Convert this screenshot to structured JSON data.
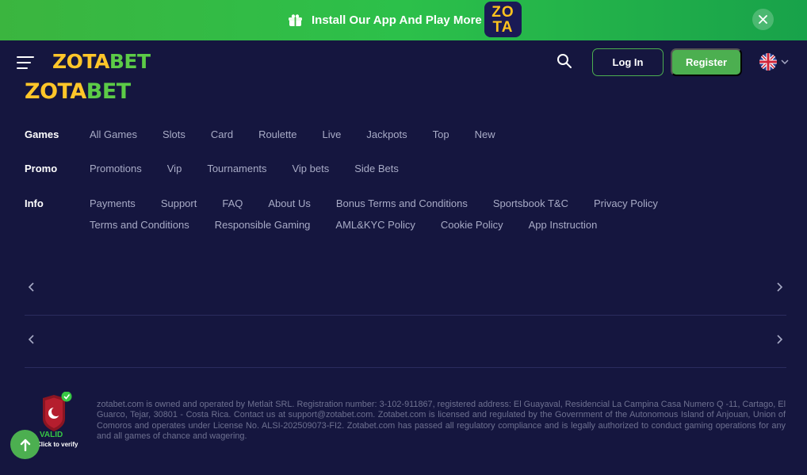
{
  "banner": {
    "text": "Install Our App And Play More",
    "app_icon_top": "ZO",
    "app_icon_bottom": "TA"
  },
  "brand": {
    "logo_part1": "ZOTA",
    "logo_part2": "BET",
    "gold": "#ffc629",
    "green": "#5ccb47",
    "accent": "#4caf50"
  },
  "header": {
    "login_label": "Log In",
    "register_label": "Register",
    "language_icon": "uk-flag-icon"
  },
  "nav": {
    "games": {
      "title": "Games",
      "links": [
        "All Games",
        "Slots",
        "Card",
        "Roulette",
        "Live",
        "Jackpots",
        "Top",
        "New"
      ]
    },
    "promo": {
      "title": "Promo",
      "links": [
        "Promotions",
        "Vip",
        "Tournaments",
        "Vip bets",
        "Side Bets"
      ]
    },
    "info": {
      "title": "Info",
      "links": [
        "Payments",
        "Support",
        "FAQ",
        "About Us",
        "Bonus Terms and Conditions",
        "Sportsbook T&C",
        "Privacy Policy",
        "Terms and Conditions",
        "Responsible Gaming",
        "AML&KYC Policy",
        "Cookie Policy",
        "App Instruction"
      ]
    }
  },
  "badge": {
    "status": "VALID",
    "action": "Click to verify"
  },
  "legal": {
    "text": "zotabet.com is owned and operated by Metlait SRL. Registration number: 3-102-911867, registered address: El Guayaval, Residencial La Campina Casa Numero Q -11, Cartago, El Guarco, Tejar, 30801 - Costa Rica. Contact us at support@zotabet.com. Zotabet.com is licensed and regulated by the Government of the Autonomous Island of Anjouan, Union of Comoros and operates under License No. ALSI-202509073-FI2. Zotabet.com has passed all regulatory compliance and is legally authorized to conduct gaming operations for any and all games of chance and wagering."
  }
}
